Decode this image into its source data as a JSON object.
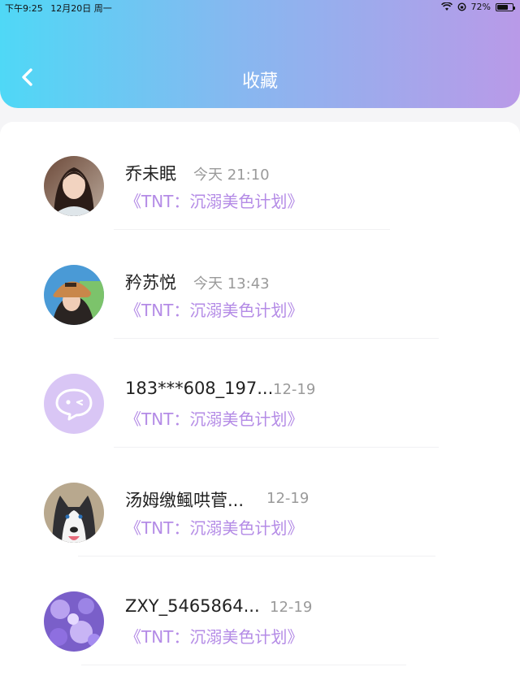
{
  "status_bar": {
    "time": "下午9:25",
    "date": "12月20日 周一",
    "battery": "72%",
    "battery_level": 0.72
  },
  "header": {
    "title": "收藏",
    "back_icon": "chevron-left-icon"
  },
  "favorites": [
    {
      "name": "乔未眠",
      "time": "今天 21:10",
      "book": "《TNT：沉溺美色计划》",
      "avatar": "photo-woman-portrait"
    },
    {
      "name": "矜苏悦",
      "time": "今天 13:43",
      "book": "《TNT：沉溺美色计划》",
      "avatar": "photo-woman-hat"
    },
    {
      "name": "183***608_197...",
      "time": "12-19",
      "book": "《TNT：沉溺美色计划》",
      "avatar": "default-chat-avatar-icon"
    },
    {
      "name": "汤姆缴鲺哄菅...",
      "time": "12-19",
      "book": "《TNT：沉溺美色计划》",
      "avatar": "photo-husky-dog"
    },
    {
      "name": "ZXY_5465864...",
      "time": "12-19",
      "book": "《TNT：沉溺美色计划》",
      "avatar": "photo-purple-flowers"
    }
  ],
  "colors": {
    "header_start": "#4fd8f6",
    "header_end": "#b99ae8",
    "book_text": "#b48be6"
  }
}
